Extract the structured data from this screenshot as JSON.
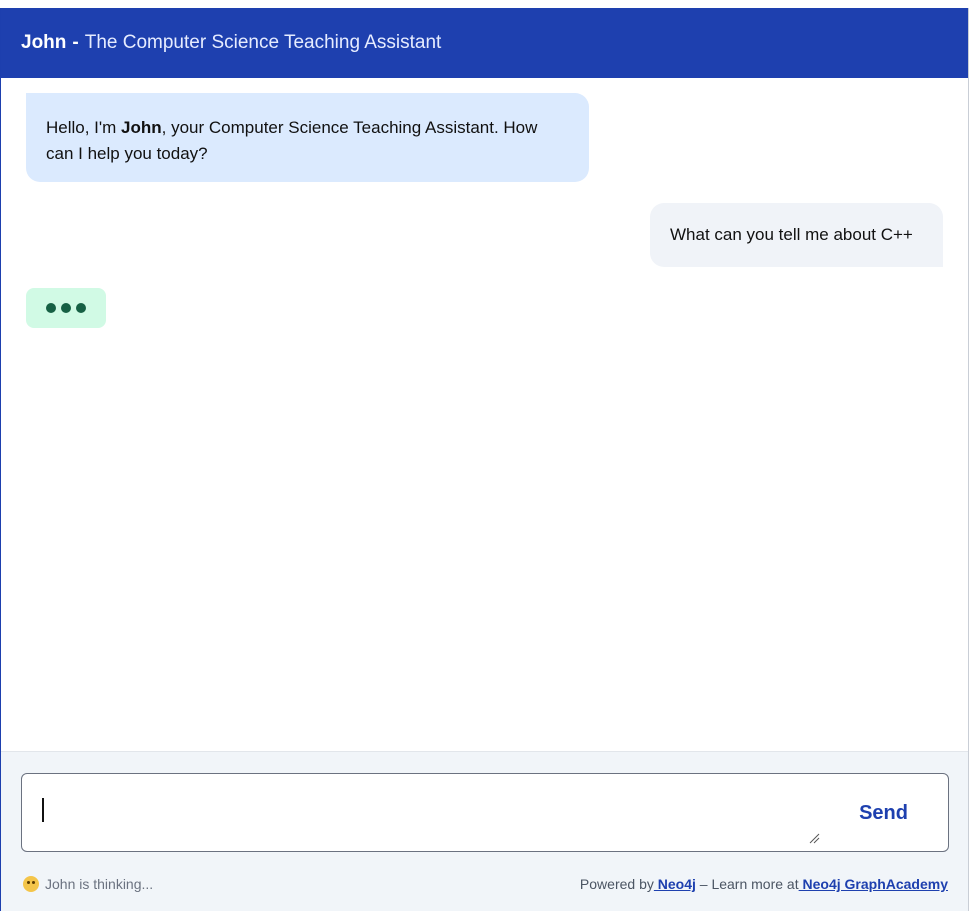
{
  "header": {
    "name": "John",
    "separator": "-",
    "subtitle": "The Computer Science Teaching Assistant"
  },
  "messages": {
    "bot": {
      "prefix": "Hello, I'm ",
      "bold_name": "John",
      "suffix": ", your Computer Science Teaching Assistant. How can I help you today?"
    },
    "user": {
      "text": "What can you tell me about C++"
    },
    "typing_indicator": "typing-dots"
  },
  "composer": {
    "value": "",
    "placeholder": "",
    "send_label": "Send"
  },
  "footer": {
    "status_icon": "thinking-face-icon",
    "status_text": "John is thinking...",
    "powered_prefix": "Powered by",
    "neo4j_link": " Neo4j",
    "learn_more": " – Learn more at",
    "academy_link": " Neo4j GraphAcademy"
  },
  "colors": {
    "header_bg": "#1e40af",
    "bot_bubble": "#dbeafe",
    "user_bubble": "#f0f3f8",
    "typing_bg": "#d1fae5",
    "accent": "#1e40af"
  }
}
